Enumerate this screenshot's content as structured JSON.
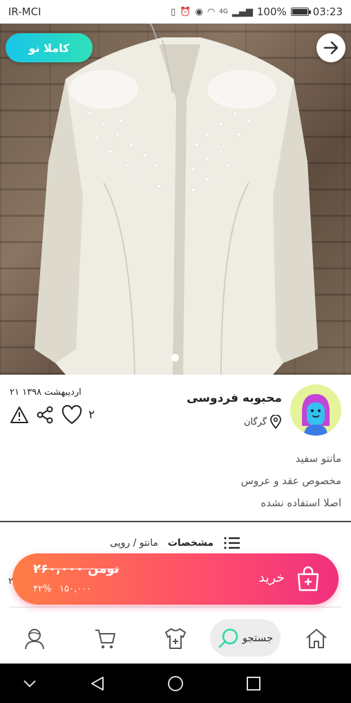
{
  "status_bar": {
    "carrier": "IR-MCI",
    "battery": "100%",
    "time": "03:23",
    "network": "4G"
  },
  "listing": {
    "badge": "کاملا نو",
    "image_dots": 1
  },
  "seller": {
    "name": "محبوبه فردوسی",
    "city": "گرگان",
    "date": "۲۱ اردیبهشت ۱۳۹۸",
    "likes": "۲"
  },
  "description": [
    "مانتو سفید",
    "مخصوص عقد و عروس",
    "اصلا استفاده نشده"
  ],
  "specs": {
    "label": "مشخصات",
    "value": "مانتو / روپی"
  },
  "buy": {
    "label": "خرید",
    "old_price": "۲۶۰,۰۰۰ تومن",
    "new_price": "۱۵۰,۰۰۰",
    "discount": "۴۲%"
  },
  "bottom_nav": {
    "search_label": "جستجو"
  },
  "colors": {
    "accent_gradient_start": "#ff7d45",
    "accent_gradient_end": "#f0307e",
    "badge_gradient_start": "#19c6e9",
    "badge_gradient_end": "#2ee0b8"
  }
}
